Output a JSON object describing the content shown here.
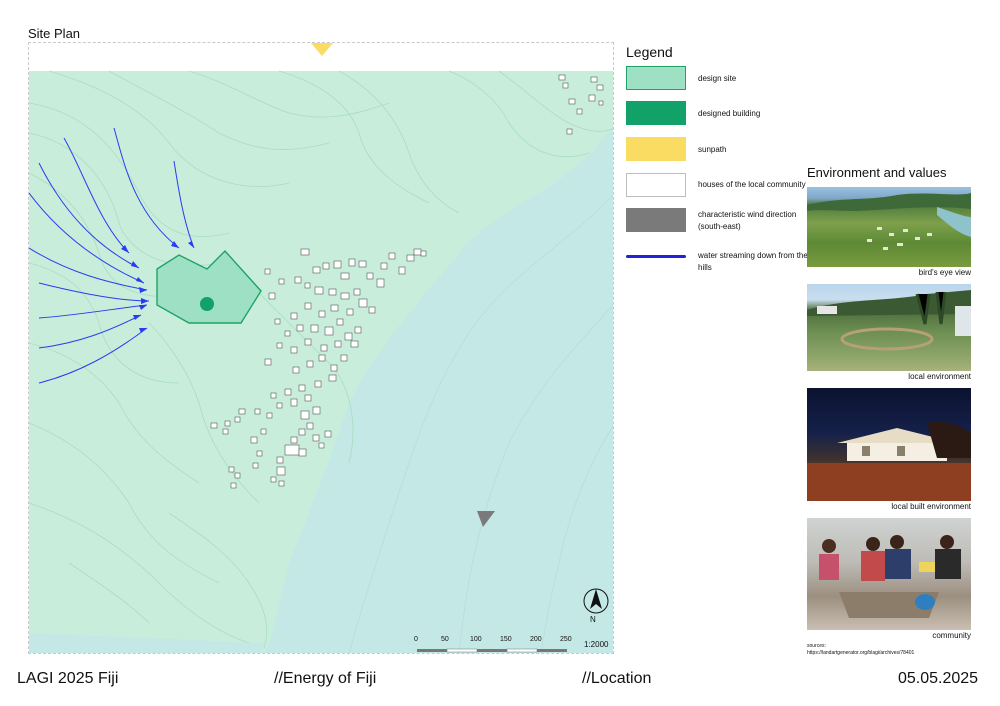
{
  "site_plan": {
    "title": "Site Plan",
    "north_label": "N",
    "scale_ratio": "1:2000",
    "scale_ticks": [
      "0",
      "50",
      "100",
      "150",
      "200",
      "250"
    ]
  },
  "legend": {
    "title": "Legend",
    "items": [
      {
        "label": "design site",
        "color": "#9ee0c4",
        "border": "#1fa463"
      },
      {
        "label": "designed building",
        "color": "#12a168",
        "border": "#12a168"
      },
      {
        "label": "sunpath",
        "color": "#fadc63",
        "border": "#fadc63"
      },
      {
        "label": "houses of the local community",
        "color": "#ffffff",
        "border": "#bdbdbd"
      },
      {
        "label": "characteristic wind direction (south-east)",
        "color": "#7a7a7a",
        "border": "#7a7a7a"
      },
      {
        "label": "water streaming down from the hills",
        "color": "#1f22d8",
        "border": "#1f22d8"
      }
    ]
  },
  "environment": {
    "title": "Environment and values",
    "photos": [
      {
        "caption": "bird's eye view"
      },
      {
        "caption": "local environment"
      },
      {
        "caption": "local built environment"
      },
      {
        "caption": "community"
      }
    ],
    "sources": [
      "sources:",
      "https://landartgenerator.org/blagi/archives/78401"
    ]
  },
  "footer": {
    "project": "LAGI 2025 Fiji",
    "theme": "//Energy of Fiji",
    "section": "//Location",
    "date": "05.05.2025"
  },
  "colors": {
    "land": "#c8eedb",
    "sea": "#c4e8e6",
    "contour": "#a9dcc2",
    "water_arrows": "#2a3cf0"
  }
}
